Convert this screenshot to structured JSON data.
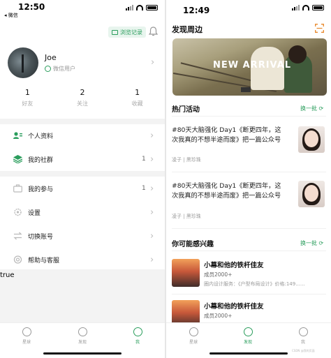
{
  "left": {
    "statusbar": {
      "time": "12:50",
      "back": "◂ 微信"
    },
    "history_label": "浏览记录",
    "profile": {
      "name": "Joe",
      "subtitle": "微信用户"
    },
    "stats": [
      {
        "num": "1",
        "label": "好友"
      },
      {
        "num": "2",
        "label": "关注"
      },
      {
        "num": "1",
        "label": "收藏"
      }
    ],
    "menu": [
      {
        "label": "个人资料",
        "count": ""
      },
      {
        "label": "我的社群",
        "count": "1"
      },
      {
        "label": "我的参与",
        "count": "1"
      },
      {
        "label": "设置",
        "count": ""
      },
      {
        "label": "切换账号",
        "count": ""
      },
      {
        "label": "帮助与客服",
        "count": ""
      }
    ],
    "true_text": "true",
    "tabs": [
      "星球",
      "发现",
      "我"
    ]
  },
  "right": {
    "statusbar": {
      "time": "12:49"
    },
    "title": "发现周边",
    "banner": {
      "headline": "NEW ARRIVAL"
    },
    "hot": {
      "title": "热门活动",
      "refresh": "换一批",
      "posts": [
        {
          "text_line1": "#80天大脑强化 Day1《断更四年，这",
          "text_line2": "次我真的不想半途而废》把一篇公众号",
          "meta": "凌子 | 黑珍珠"
        },
        {
          "text_line1": "#80天大脑强化 Day1《断更四年，这",
          "text_line2": "次我真的不想半途而废》把一篇公众号",
          "meta": "凌子 | 黑珍珠"
        }
      ]
    },
    "interest": {
      "title": "你可能感兴趣",
      "refresh": "换一批",
      "groups": [
        {
          "name": "小幕和他的铁杆佳友",
          "count": "成员2000+",
          "desc": "圈内设计服务：《户型布局设计》价格:149......"
        },
        {
          "name": "小幕和他的铁杆佳友",
          "count": "成员2000+",
          "desc": ""
        }
      ]
    },
    "tabs": [
      "星球",
      "发现",
      "我"
    ],
    "watermark": "CSDN @我的页面"
  },
  "colors": {
    "accent": "#2a9d5c",
    "band": "#f3f3f3"
  }
}
